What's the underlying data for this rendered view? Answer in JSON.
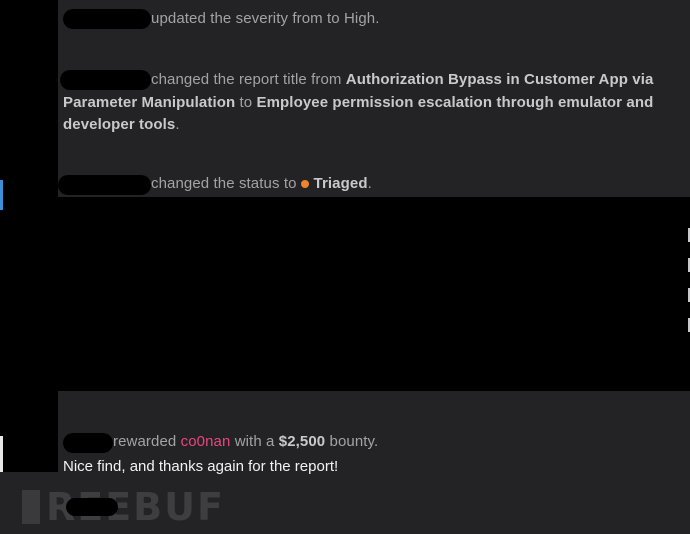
{
  "activities": [
    {
      "action": "updated the severity from to High."
    },
    {
      "action": "changed the report title from ",
      "old_title": "Authorization Bypass in Customer App via Parameter Manipulation",
      "connector": " to ",
      "new_title": "Employee permission escalation through emulator and developer tools",
      "end": "."
    },
    {
      "action": "changed the status to",
      "status": "Triaged",
      "status_color": "#f0842c",
      "end": "."
    },
    {
      "action": "rewarded ",
      "recipient": "co0nan",
      "mid": " with a ",
      "amount": "$2,500",
      "end": " bounty."
    }
  ],
  "comment": "Nice find, and thanks again for the report!",
  "watermark": {
    "text": "REEBUF"
  },
  "colors": {
    "background": "#232325",
    "username": "#e8457d",
    "activity_text": "#a3a3a6"
  }
}
